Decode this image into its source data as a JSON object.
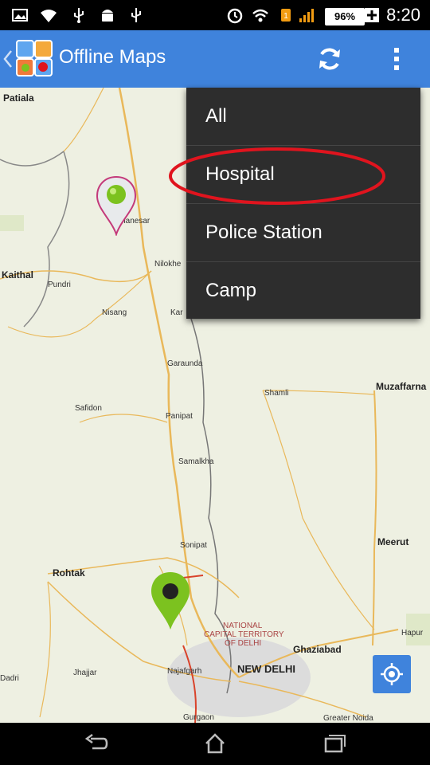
{
  "status": {
    "battery": "96%",
    "time": "8:20"
  },
  "appbar": {
    "title": "Offline Maps"
  },
  "menu": {
    "items": [
      "All",
      "Hospital",
      "Police Station",
      "Camp"
    ]
  },
  "map": {
    "places": {
      "patiala": "Patiala",
      "thanesar": "Thanesar",
      "kaithal": "Kaithal",
      "pundri": "Pundri",
      "nilokheri": "Nilokhe",
      "nisang": "Nisang",
      "karnal": "Kar",
      "garaunda": "Garaunda",
      "shamli": "Shamli",
      "muzaffarnagar": "Muzaffarna",
      "safidon": "Safidon",
      "panipat": "Panipat",
      "samalkha": "Samalkha",
      "sonipat": "Sonipat",
      "meerut": "Meerut",
      "rohtak": "Rohtak",
      "nct1": "NATIONAL",
      "nct2": "CAPITAL TERRITORY",
      "nct3": "OF DELHI",
      "ghaziabad": "Ghaziabad",
      "hapur": "Hapur",
      "dadri": "Dadri",
      "jhajjar": "Jhajjar",
      "najafgarh": "Najafgarh",
      "newdelhi": "NEW DELHI",
      "gurgaon": "Gurgaon",
      "greaternoida": "Greater Noida"
    }
  },
  "colors": {
    "accent": "#3f83dc",
    "menu_bg": "#2d2d2d",
    "highlight": "#e0141e",
    "pin_green": "#7cc21f"
  }
}
